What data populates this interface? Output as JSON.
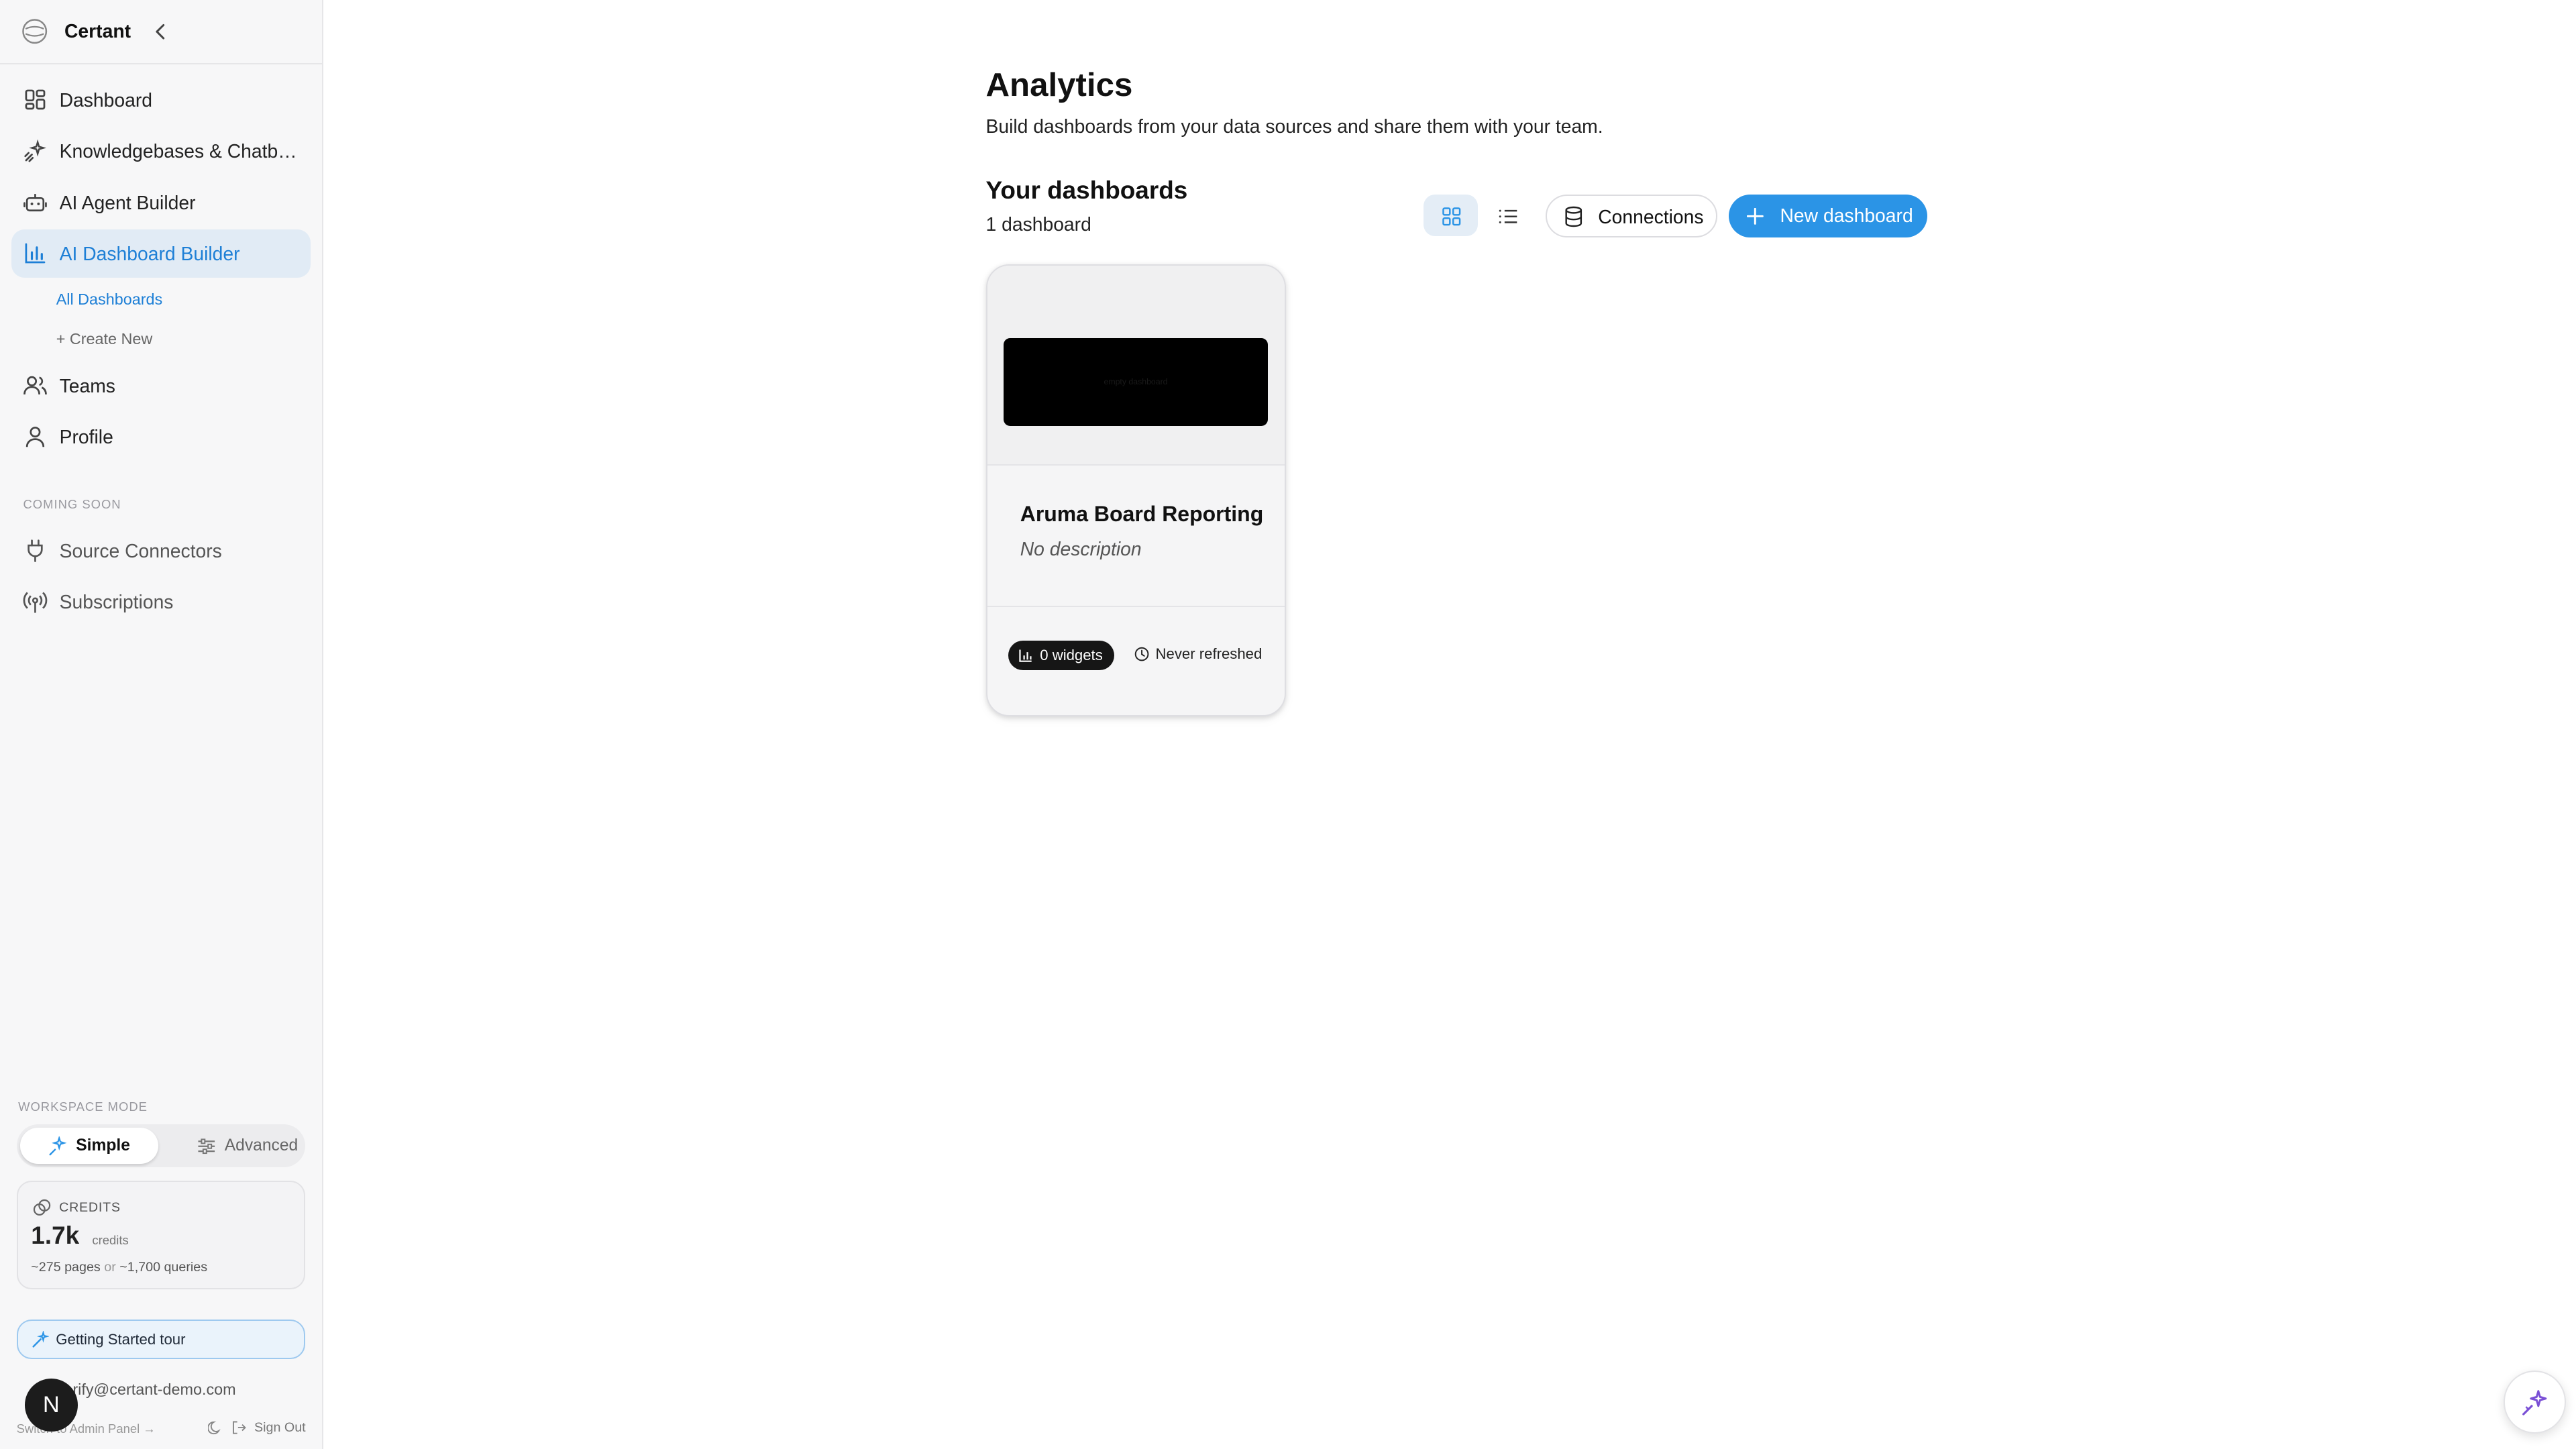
{
  "brand": {
    "name": "Certant"
  },
  "nav": [
    {
      "label": "Dashboard",
      "icon": "dashboard-grid-icon"
    },
    {
      "label": "Knowledgebases & Chatbots",
      "icon": "sparkle-network-icon"
    },
    {
      "label": "AI Agent Builder",
      "icon": "bot-icon"
    },
    {
      "label": "AI Dashboard Builder",
      "icon": "bar-chart-icon",
      "active": true
    },
    {
      "label": "Teams",
      "icon": "users-icon"
    },
    {
      "label": "Profile",
      "icon": "user-icon"
    }
  ],
  "subnav": [
    {
      "label": "All Dashboards",
      "active": true
    },
    {
      "label": "+ Create New"
    }
  ],
  "coming_soon": {
    "label": "COMING SOON",
    "items": [
      {
        "label": "Source Connectors",
        "icon": "plug-icon"
      },
      {
        "label": "Subscriptions",
        "icon": "broadcast-icon"
      }
    ]
  },
  "workspace_mode": {
    "label": "WORKSPACE MODE",
    "options": [
      "Simple",
      "Advanced"
    ],
    "selected": "Simple"
  },
  "credits": {
    "label": "CREDITS",
    "value": "1.7k",
    "unit": "credits",
    "pages": "~275 pages",
    "or": "or",
    "queries": "~1,700 queries"
  },
  "tour": {
    "label": "Getting Started tour"
  },
  "user": {
    "email": "verify@certant-demo.com",
    "avatar_letter": "N",
    "admin_link": "Switch to Admin Panel →",
    "sign_out": "Sign Out"
  },
  "main": {
    "title": "Analytics",
    "subtitle": "Build dashboards from your data sources and share them with your team.",
    "section_title": "Your dashboards",
    "section_count": "1 dashboard",
    "connections_label": "Connections",
    "new_dashboard_label": "New dashboard",
    "view_mode": "grid"
  },
  "dashboards": [
    {
      "title": "Aruma Board Reporting",
      "description": "No description",
      "preview_text": "empty dashboard",
      "widgets": "0 widgets",
      "refreshed": "Never refreshed"
    }
  ],
  "colors": {
    "accent": "#2b94e6",
    "active_nav_bg": "#e1ebf5",
    "active_nav_text": "#1d7fd6",
    "sidebar_bg": "#f7f7f8"
  }
}
